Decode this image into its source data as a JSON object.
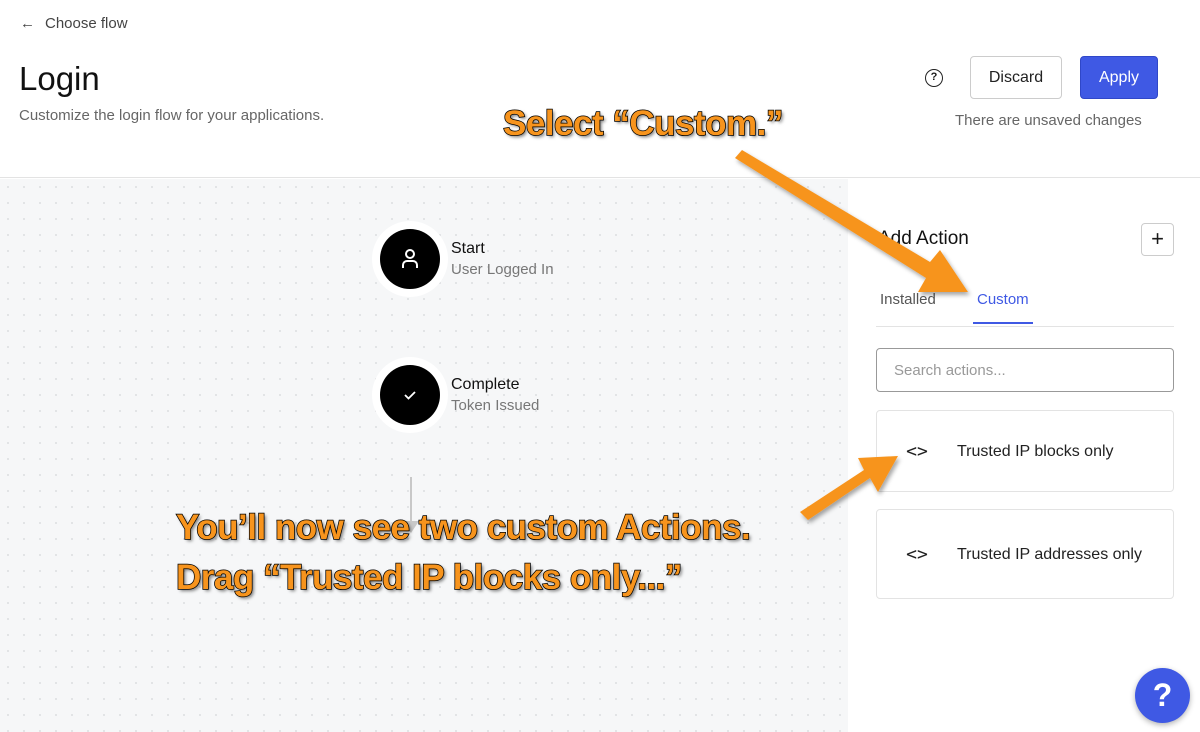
{
  "header": {
    "back_label": "Choose flow",
    "title": "Login",
    "subtitle": "Customize the login flow for your applications.",
    "help_icon": "?",
    "discard": "Discard",
    "apply": "Apply",
    "status": "There are unsaved changes"
  },
  "flow": {
    "nodes": [
      {
        "title": "Start",
        "subtitle": "User Logged In",
        "icon": "user-icon"
      },
      {
        "title": "Complete",
        "subtitle": "Token Issued",
        "icon": "check-icon"
      }
    ]
  },
  "panel": {
    "title": "Add Action",
    "add_icon": "+",
    "tabs": [
      {
        "label": "Installed"
      },
      {
        "label": "Custom",
        "active": true
      }
    ],
    "search_placeholder": "Search actions...",
    "actions": [
      {
        "label": "Trusted IP blocks only",
        "icon": "<>"
      },
      {
        "label": "Trusted IP addresses only",
        "icon": "<>"
      }
    ]
  },
  "help_fab": "?",
  "annotations": {
    "a1": "Select “Custom.”",
    "a2_line1": "You’ll now see two custom Actions.",
    "a2_line2": "Drag “Trusted IP blocks only...”"
  },
  "colors": {
    "accent": "#3f59e4",
    "annotation": "#f7941d"
  }
}
